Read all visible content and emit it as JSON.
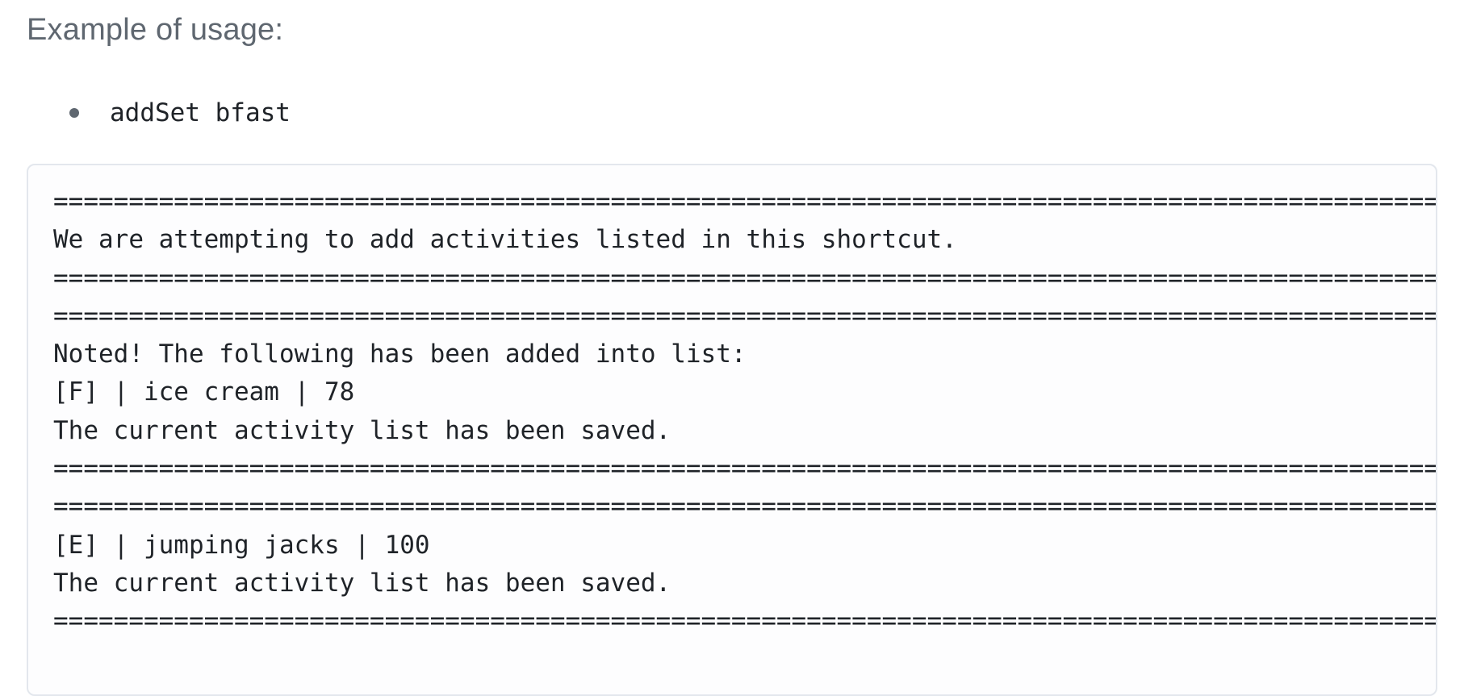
{
  "heading": "Example of usage:",
  "usage": {
    "items": [
      {
        "code": "addSet bfast"
      }
    ]
  },
  "code_block": {
    "lines": [
      "==================================================================================================",
      "We are attempting to add activities listed in this shortcut.",
      "==================================================================================================",
      "==================================================================================================",
      "Noted! The following has been added into list:",
      "[F] | ice cream | 78",
      "The current activity list has been saved.",
      "==================================================================================================",
      "==================================================================================================",
      "[E] | jumping jacks | 100",
      "The current activity list has been saved.",
      "=================================================================================================="
    ]
  }
}
